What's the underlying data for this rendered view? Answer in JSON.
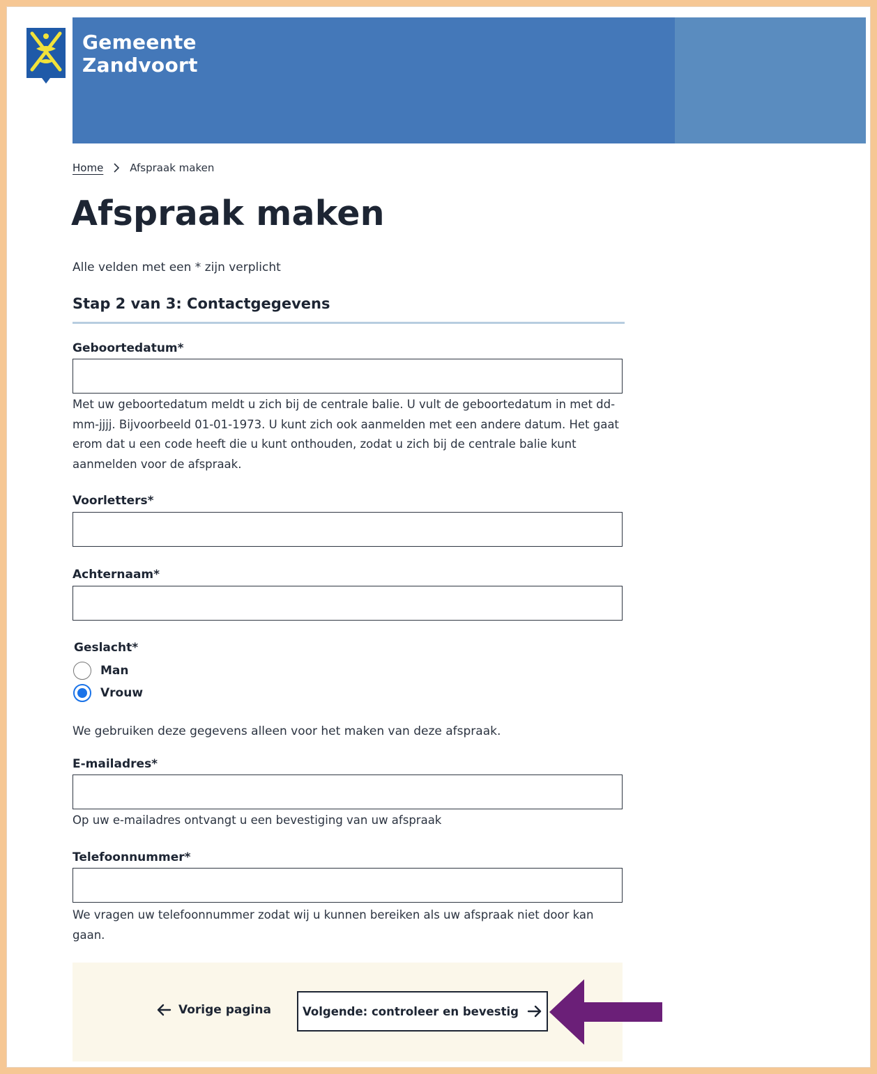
{
  "header": {
    "brand_line1": "Gemeente",
    "brand_line2": "Zandvoort",
    "logo_icon": "coat-of-arms-icon",
    "colors": {
      "primary": "#4478b9",
      "secondary": "#5a8cbf",
      "logo": "#1f5aa8",
      "logo_accent": "#f2e33a"
    }
  },
  "breadcrumb": {
    "home": "Home",
    "separator_icon": "chevron-right-icon",
    "current": "Afspraak maken"
  },
  "page": {
    "title": "Afspraak maken",
    "required_note": "Alle velden met een * zijn verplicht",
    "step_title": "Stap 2 van 3: Contactgegevens"
  },
  "form": {
    "birthdate": {
      "label": "Geboortedatum*",
      "value": "",
      "help": "Met uw geboortedatum meldt u zich bij de centrale balie. U vult de geboortedatum in met dd-mm-jjjj. Bijvoorbeeld 01-01-1973. U kunt zich ook aanmelden met een andere datum. Het gaat erom dat u een code heeft die u kunt onthouden, zodat u zich bij de centrale balie kunt aanmelden voor de afspraak."
    },
    "initials": {
      "label": "Voorletters*",
      "value": ""
    },
    "surname": {
      "label": "Achternaam*",
      "value": ""
    },
    "gender": {
      "legend": "Geslacht*",
      "options": [
        {
          "label": "Man",
          "checked": false
        },
        {
          "label": "Vrouw",
          "checked": true
        }
      ]
    },
    "privacy_note": "We gebruiken deze gegevens alleen voor het maken van deze afspraak.",
    "email": {
      "label": "E-mailadres*",
      "value": "",
      "help": "Op uw e-mailadres ontvangt u een bevestiging van uw afspraak"
    },
    "phone": {
      "label": "Telefoonnummer*",
      "value": "",
      "help": "We vragen uw telefoonnummer zodat wij u kunnen bereiken als uw afspraak niet door kan gaan."
    }
  },
  "navigation": {
    "prev_label": "Vorige pagina",
    "prev_icon": "arrow-left-icon",
    "next_label": "Volgende: controleer en bevestig",
    "next_icon": "arrow-right-icon",
    "panel_color": "#fbf7ea"
  },
  "annotation": {
    "callout_icon": "arrow-callout-icon",
    "color": "#6b1f78"
  }
}
